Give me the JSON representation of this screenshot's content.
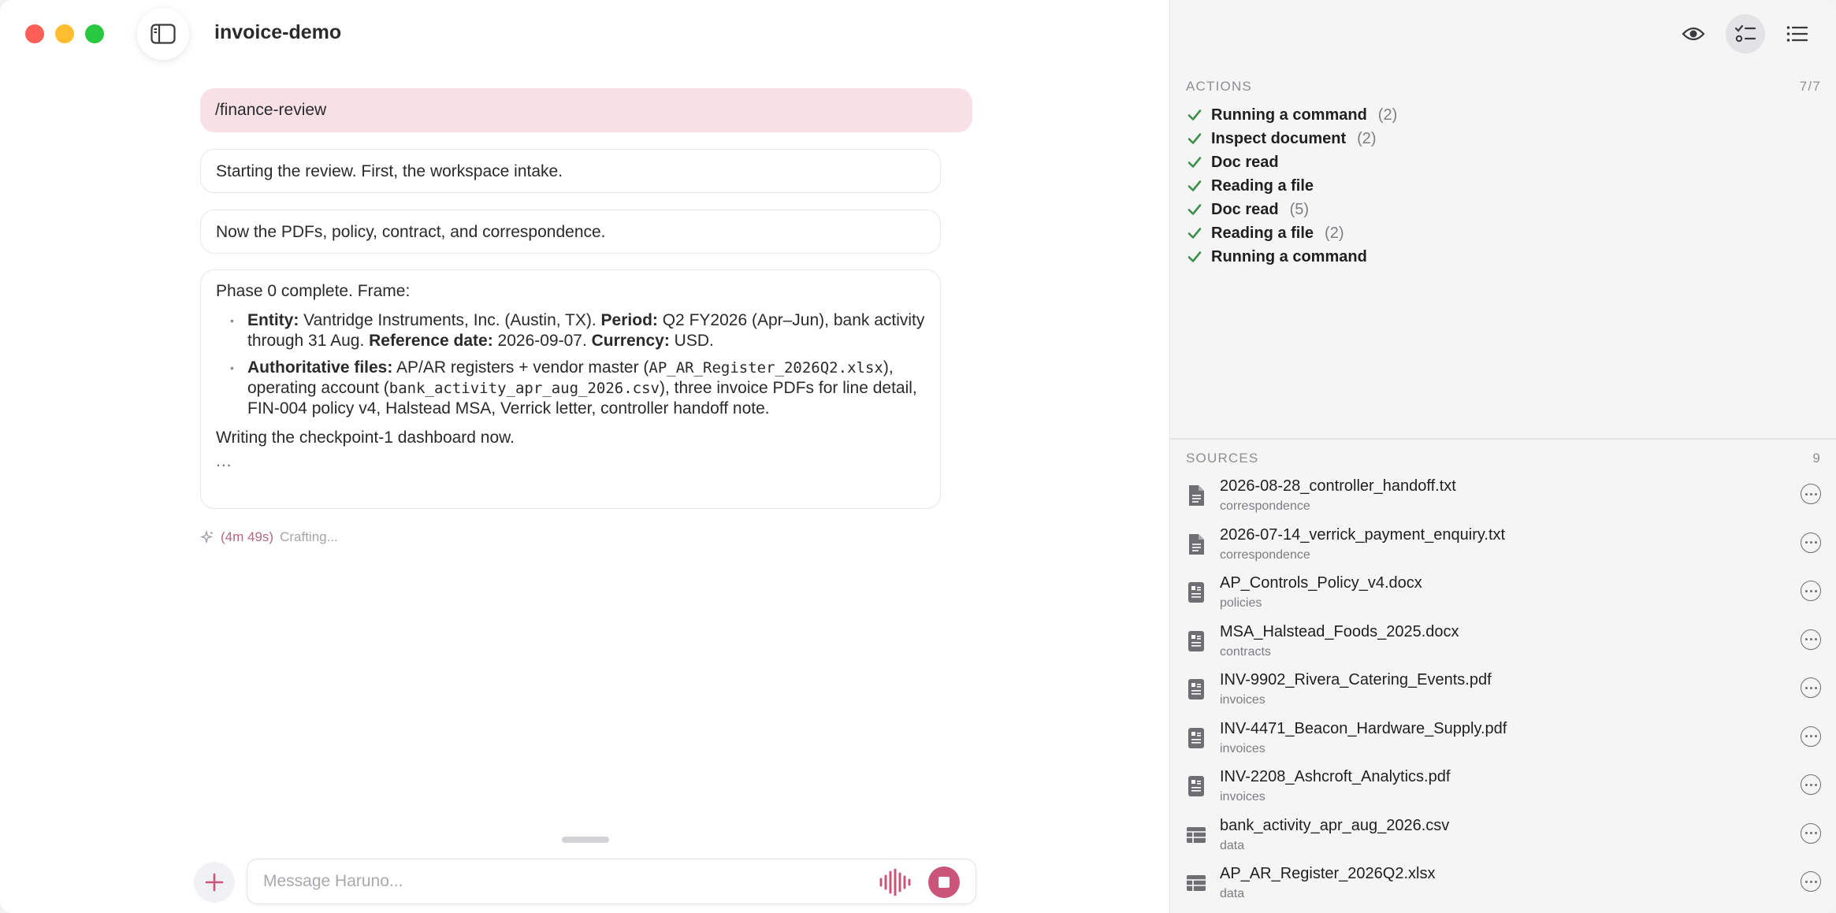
{
  "app": {
    "title": "invoice-demo"
  },
  "chat": {
    "user_message": "/finance-review",
    "messages": [
      "Starting the review. First, the workspace intake.",
      "Now the PDFs, policy, contract, and correspondence."
    ],
    "summary": {
      "intro": "Phase 0 complete. Frame:",
      "b1": {
        "k_entity": "Entity:",
        "v_entity": " Vantridge Instruments, Inc. (Austin, TX). ",
        "k_period": "Period:",
        "v_period": " Q2 FY2026 (Apr–Jun), bank activity through 31 Aug. ",
        "k_ref": "Reference date:",
        "v_ref": " 2026-09-07. ",
        "k_cur": "Currency:",
        "v_cur": " USD."
      },
      "b2": {
        "k_files": "Authoritative files:",
        "t1": " AP/AR registers + vendor master (",
        "f1": "AP_AR_Register_2026Q2.xlsx",
        "t2": "), operating account (",
        "f2": "bank_activity_apr_aug_2026.csv",
        "t3": "), three invoice PDFs for line detail, FIN-004 policy v4, Halstead MSA, Verrick letter, controller handoff note."
      },
      "outro": "Writing the checkpoint-1 dashboard now.",
      "ellipsis": "..."
    },
    "status": {
      "elapsed": "(4m 49s)",
      "state": "Crafting..."
    }
  },
  "composer": {
    "placeholder": "Message Haruno..."
  },
  "actions": {
    "title": "ACTIONS",
    "count": "7/7",
    "items": [
      {
        "label": "Running a command",
        "count": "(2)"
      },
      {
        "label": "Inspect document",
        "count": "(2)"
      },
      {
        "label": "Doc read",
        "count": ""
      },
      {
        "label": "Reading a file",
        "count": ""
      },
      {
        "label": "Doc read",
        "count": "(5)"
      },
      {
        "label": "Reading a file",
        "count": "(2)"
      },
      {
        "label": "Running a command",
        "count": ""
      }
    ]
  },
  "sources": {
    "title": "SOURCES",
    "count": "9",
    "items": [
      {
        "name": "2026-08-28_controller_handoff.txt",
        "category": "correspondence",
        "icon": "text-file-icon"
      },
      {
        "name": "2026-07-14_verrick_payment_enquiry.txt",
        "category": "correspondence",
        "icon": "text-file-icon"
      },
      {
        "name": "AP_Controls_Policy_v4.docx",
        "category": "policies",
        "icon": "document-file-icon"
      },
      {
        "name": "MSA_Halstead_Foods_2025.docx",
        "category": "contracts",
        "icon": "document-file-icon"
      },
      {
        "name": "INV-9902_Rivera_Catering_Events.pdf",
        "category": "invoices",
        "icon": "document-file-icon"
      },
      {
        "name": "INV-4471_Beacon_Hardware_Supply.pdf",
        "category": "invoices",
        "icon": "document-file-icon"
      },
      {
        "name": "INV-2208_Ashcroft_Analytics.pdf",
        "category": "invoices",
        "icon": "document-file-icon"
      },
      {
        "name": "bank_activity_apr_aug_2026.csv",
        "category": "data",
        "icon": "table-file-icon"
      },
      {
        "name": "AP_AR_Register_2026Q2.xlsx",
        "category": "data",
        "icon": "table-file-icon"
      }
    ]
  },
  "colors": {
    "accent": "#c9567a",
    "user_bubble": "#f7e1e6",
    "check": "#3f8f4a"
  }
}
